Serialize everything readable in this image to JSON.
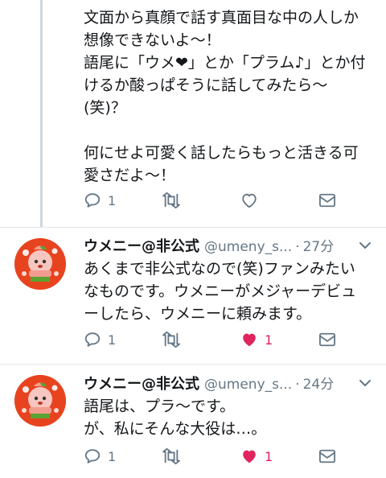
{
  "tweets": [
    {
      "text": "文面から真顔で話す真面目な中の人しか\n想像できないよ〜！\n語尾に「ウメ❤」とか「プラム♪」とか付\nけるか酸っぱそうに話してみたら〜\n(笑)？\n\n何にせよ可愛く話したらもっと活きる可\n愛さだよ〜！",
      "reply_count": "1",
      "like_count": "",
      "liked": false
    },
    {
      "name": "ウメニー@非公式",
      "handle": "@umeny_s...",
      "time": "27分",
      "text": "あくまで非公式なので(笑)ファンみたい\nなものです。ウメニーがメジャーデビュ\nーしたら、ウメニーに頼みます。",
      "reply_count": "1",
      "like_count": "1",
      "liked": true
    },
    {
      "name": "ウメニー@非公式",
      "handle": "@umeny_s...",
      "time": "24分",
      "text": "語尾は、プラ〜です。\nが、私にそんな大役は…。",
      "reply_count": "1",
      "like_count": "1",
      "liked": true
    }
  ],
  "colors": {
    "like_active": "#e0245e",
    "icon_gray": "#657786",
    "thread_line": "#ccd6dd",
    "avatar_bg": "#e8431f"
  },
  "icons": [
    "reply-icon",
    "retweet-icon",
    "like-icon",
    "dm-icon",
    "chevron-down-icon"
  ]
}
